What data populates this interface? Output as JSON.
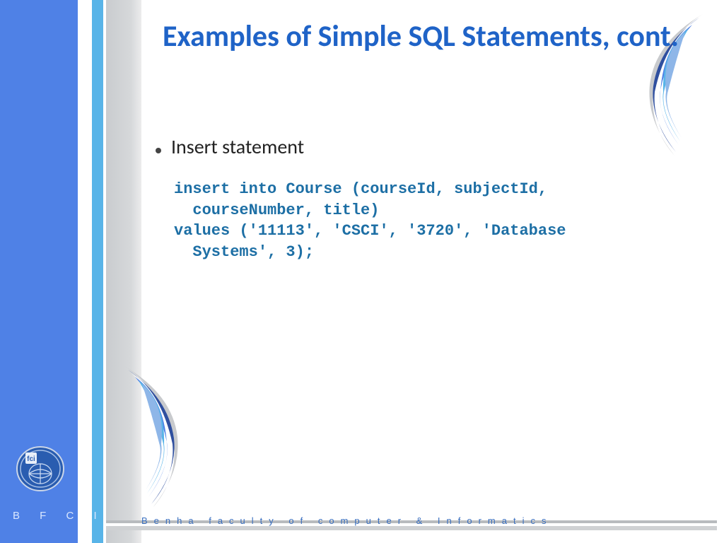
{
  "title": "Examples of Simple SQL Statements, cont.",
  "bullet": "Insert statement",
  "code": "insert into Course (courseId, subjectId,\n  courseNumber, title)\nvalues ('11113', 'CSCI', '3720', 'Database\n  Systems', 3);",
  "side_label": "B F C I",
  "footer": "Benha faculty of computer & Informatics",
  "logo_text": "fci"
}
